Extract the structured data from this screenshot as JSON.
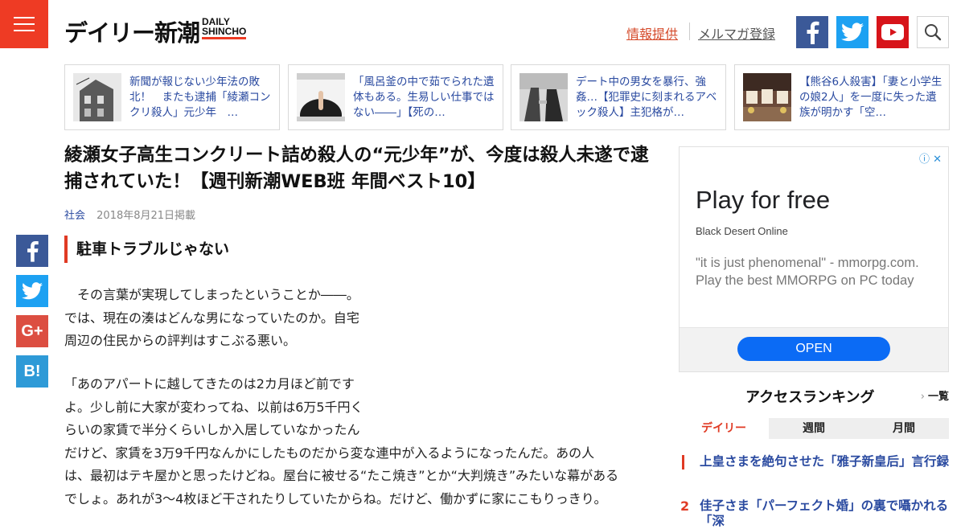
{
  "header": {
    "logo_jp": "デイリー新潮",
    "logo_en_1": "DAILY",
    "logo_en_2": "SHINCHO",
    "link_info": "情報提供",
    "link_mail": "メルマガ登録",
    "icons": [
      "menu-icon",
      "facebook-icon",
      "twitter-icon",
      "youtube-icon",
      "search-icon"
    ],
    "colors": {
      "brand_red": "#ee3b24",
      "facebook": "#3b5998",
      "twitter": "#1da1f2",
      "youtube": "#d7141a"
    }
  },
  "cards": [
    {
      "text": "新聞が報じない少年法の敗北！　またも逮捕「綾瀬コンクリ殺人」元少年　…"
    },
    {
      "text": "「風呂釜の中で茹でられた遺体もある。生易しい仕事ではない――」【死の…"
    },
    {
      "text": "デート中の男女を暴行、強姦…【犯罪史に刻まれるアベック殺人】主犯格が…"
    },
    {
      "text": "【熊谷6人殺害】「妻と小学生の娘2人」を一度に失った遺族が明かす「空…"
    }
  ],
  "article": {
    "title": "綾瀬女子高生コンクリート詰め殺人の“元少年”が、今度は殺人未遂で逮捕されていた！【週刊新潮WEB班 年間ベスト10】",
    "category": "社会",
    "date": "2018年8月21日掲載",
    "subhead": "駐車トラブルじゃない",
    "para1": [
      "　その言葉が実現してしまったということか――。",
      "では、現在の湊はどんな男になっていたのか。自宅",
      "周辺の住民からの評判はすこぶる悪い。"
    ],
    "para2": [
      "「あのアパートに越してきたのは2カ月ほど前です",
      "よ。少し前に大家が変わってね、以前は6万5千円く",
      "らいの家賃で半分くらいしか入居していなかったん",
      "だけど、家賃を3万9千円なんかにしたものだから変な連中が入るようになったんだ。あの人",
      "は、最初はテキ屋かと思ったけどね。屋台に被せる“たこ焼き”とか“大判焼き”みたいな幕がある",
      "でしょ。あれが3～4枚ほど干されたりしていたからね。だけど、働かずに家にこもりっきり。"
    ]
  },
  "share_icons": [
    "facebook-icon",
    "twitter-icon",
    "google-plus-icon",
    "hatena-bookmark-icon"
  ],
  "share_labels": {
    "gplus": "G+",
    "hatena": "B!"
  },
  "ad": {
    "choices": "ⓘ ✕",
    "title": "Play for free",
    "advertiser": "Black Desert Online",
    "description": "\"it is just phenomenal\" - mmorpg.com. Play the best MMORPG on PC today",
    "button": "OPEN"
  },
  "ranking": {
    "title": "アクセスランキング",
    "more": "一覧",
    "tabs": [
      "デイリー",
      "週間",
      "月間"
    ],
    "active_tab": "デイリー",
    "items": [
      {
        "rank": "1",
        "text": "上皇さまを絶句させた「雅子新皇后」言行録"
      },
      {
        "rank": "2",
        "text": "佳子さま「パーフェクト婚」の裏で囁かれる「深"
      }
    ]
  }
}
